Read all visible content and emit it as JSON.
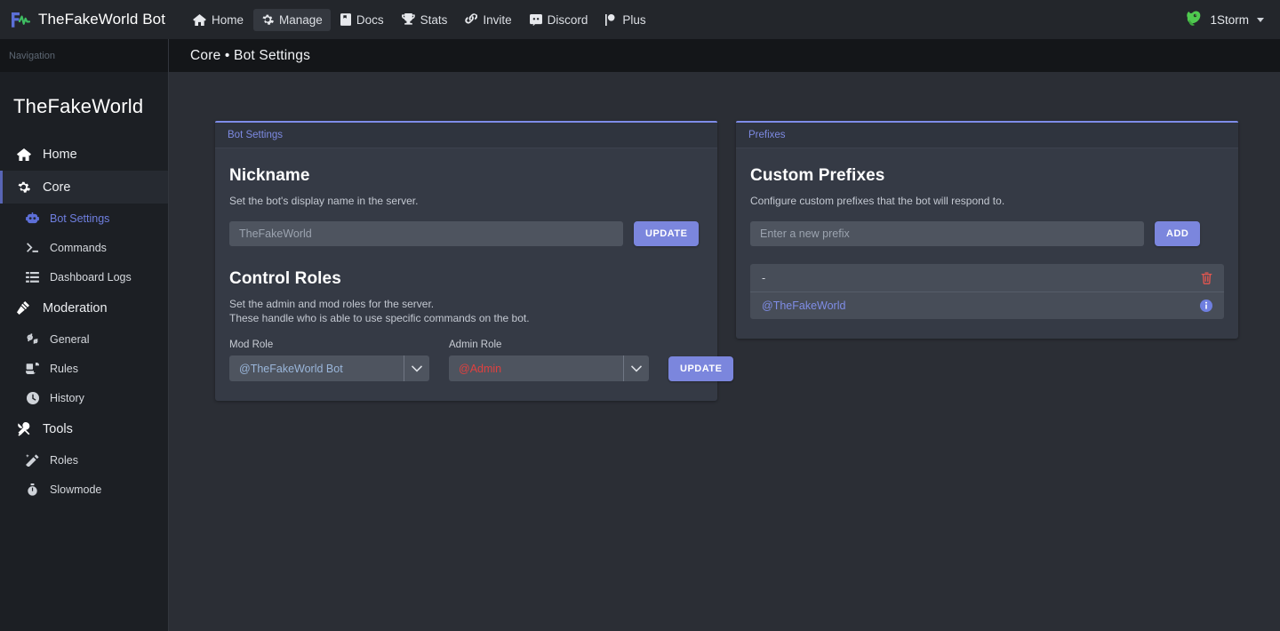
{
  "navbar": {
    "brand": "TheFakeWorld Bot",
    "brand_logo_icon": "chart-pulse-logo-icon",
    "links": [
      {
        "label": "Home",
        "icon": "home-icon",
        "active": false
      },
      {
        "label": "Manage",
        "icon": "gear-icon",
        "active": true
      },
      {
        "label": "Docs",
        "icon": "book-icon",
        "active": false
      },
      {
        "label": "Stats",
        "icon": "trophy-icon",
        "active": false
      },
      {
        "label": "Invite",
        "icon": "link-icon",
        "active": false
      },
      {
        "label": "Discord",
        "icon": "discord-icon",
        "active": false
      },
      {
        "label": "Plus",
        "icon": "flag-icon",
        "active": false
      }
    ],
    "user": {
      "name": "1Storm",
      "avatar_icon": "green-creature-avatar-icon",
      "caret_icon": "caret-down-icon"
    }
  },
  "sidebar": {
    "nav_label": "Navigation",
    "server_name": "TheFakeWorld",
    "items": [
      {
        "label": "Home",
        "icon": "home-icon",
        "type": "group"
      },
      {
        "label": "Core",
        "icon": "gear-icon",
        "type": "group",
        "active": true
      },
      {
        "label": "Bot Settings",
        "icon": "robot-icon",
        "type": "sub",
        "active": true
      },
      {
        "label": "Commands",
        "icon": "terminal-icon",
        "type": "sub"
      },
      {
        "label": "Dashboard Logs",
        "icon": "list-icon",
        "type": "sub"
      },
      {
        "label": "Moderation",
        "icon": "gavel-icon",
        "type": "group"
      },
      {
        "label": "General",
        "icon": "cogs-icon",
        "type": "sub"
      },
      {
        "label": "Rules",
        "icon": "scroll-icon",
        "type": "sub"
      },
      {
        "label": "History",
        "icon": "clock-icon",
        "type": "sub"
      },
      {
        "label": "Tools",
        "icon": "tools-icon",
        "type": "group"
      },
      {
        "label": "Roles",
        "icon": "magic-wand-icon",
        "type": "sub"
      },
      {
        "label": "Slowmode",
        "icon": "stopwatch-icon",
        "type": "sub"
      }
    ]
  },
  "page": {
    "header_title": "Core • Bot Settings"
  },
  "bot_settings_card": {
    "card_title": "Bot Settings",
    "nickname": {
      "heading": "Nickname",
      "description": "Set the bot's display name in the server.",
      "input_placeholder": "TheFakeWorld",
      "input_value": "",
      "button": "UPDATE"
    },
    "control_roles": {
      "heading": "Control Roles",
      "description_line1": "Set the admin and mod roles for the server.",
      "description_line2": "These handle who is able to use specific commands on the bot.",
      "mod_label": "Mod Role",
      "mod_value": "@TheFakeWorld Bot",
      "mod_color": "#9ab6da",
      "admin_label": "Admin Role",
      "admin_value": "@Admin",
      "admin_color": "#e0403f",
      "button": "UPDATE",
      "chevron_icon": "chevron-down-icon"
    }
  },
  "prefixes_card": {
    "card_title": "Prefixes",
    "heading": "Custom Prefixes",
    "description": "Configure custom prefixes that the bot will respond to.",
    "input_placeholder": "Enter a new prefix",
    "input_value": "",
    "button": "ADD",
    "rows": [
      {
        "text": "-",
        "style": "plain",
        "action_icon": "trash-icon",
        "action_color": "#e4564f"
      },
      {
        "text": "@TheFakeWorld",
        "style": "mention",
        "action_icon": "info-icon",
        "action_color": "#7f8de6"
      }
    ]
  },
  "colors": {
    "page_bg": "#2b2e35",
    "card_bg": "#353a45",
    "card_accent": "#7e8ce8",
    "sidebar_bg": "#1c1f24",
    "navbar_bg": "#23262b",
    "button": "#7b86dd",
    "input_bg": "#4e545f"
  }
}
